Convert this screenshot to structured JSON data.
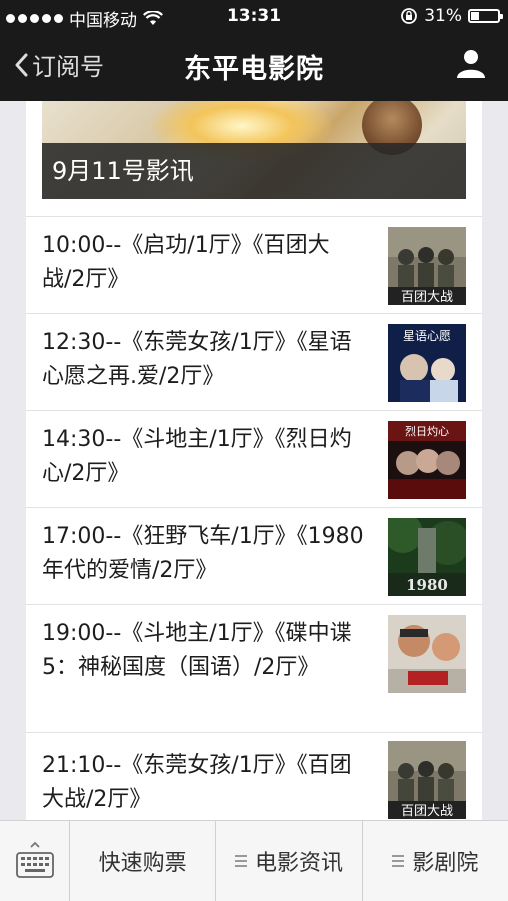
{
  "status_bar": {
    "carrier": "中国移动",
    "time": "13:31",
    "battery": "31%",
    "battery_level": 0.31,
    "icons": [
      "signal-dots-icon",
      "wifi-icon",
      "orientation-lock-icon",
      "battery-icon"
    ]
  },
  "nav": {
    "back_label": "订阅号",
    "title": "东平电影院",
    "icons": [
      "chevron-left-icon",
      "profile-icon"
    ]
  },
  "banner": {
    "caption": "9月11号影讯"
  },
  "schedule": [
    {
      "text": "10:00--《启功/1厅》《百团大战/2厅》",
      "thumb_caption": "百团大战"
    },
    {
      "text": "12:30--《东莞女孩/1厅》《星语心愿之再.爱/2厅》",
      "thumb_caption": "星语心愿"
    },
    {
      "text": "14:30--《斗地主/1厅》《烈日灼心/2厅》",
      "thumb_caption": "烈日灼心"
    },
    {
      "text": "17:00--《狂野飞车/1厅》《1980年代的爱情/2厅》",
      "thumb_caption": "1980"
    },
    {
      "text": "19:00--《斗地主/1厅》《碟中谍5：神秘国度（国语）/2厅》",
      "thumb_caption": ""
    },
    {
      "text": "21:10--《东莞女孩/1厅》《百团大战/2厅》",
      "thumb_caption": "百团大战"
    }
  ],
  "bottom_menu": {
    "keyboard_icon": "keyboard-icon",
    "tabs": [
      {
        "label": "快速购票",
        "has_submenu": false
      },
      {
        "label": "电影资讯",
        "has_submenu": true
      },
      {
        "label": "影剧院",
        "has_submenu": true
      }
    ]
  },
  "colors": {
    "header_bg": "#1a1a1a",
    "page_bg": "#e9e9ee",
    "caption_bg": "#2a2a2a"
  }
}
